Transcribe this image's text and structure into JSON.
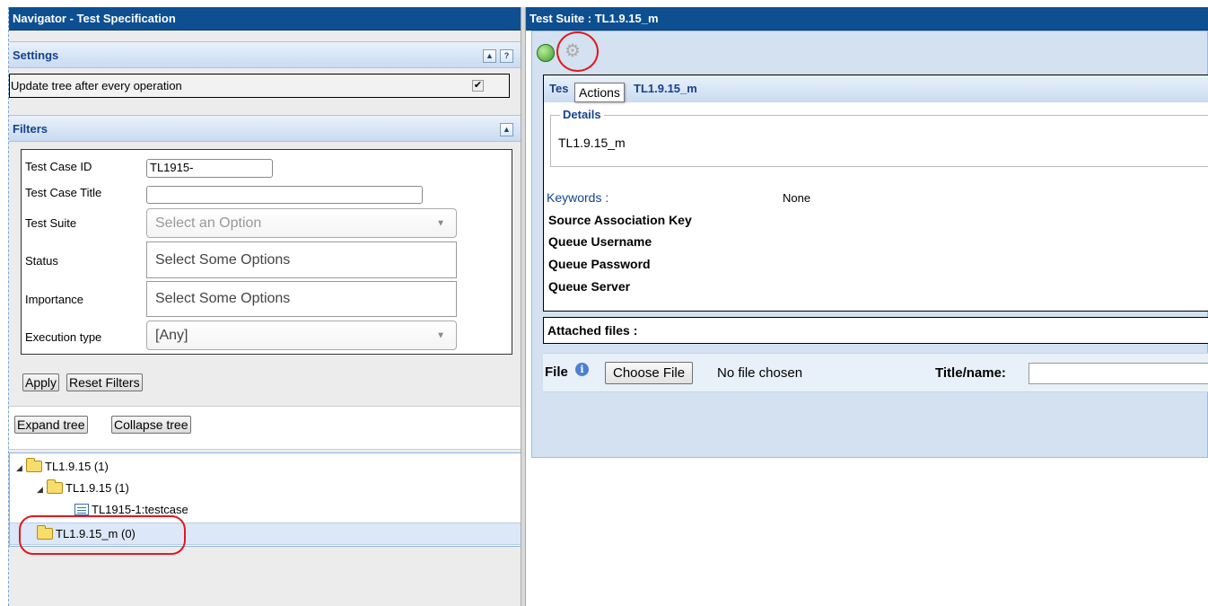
{
  "navigator": {
    "title": "Navigator - Test Specification",
    "settings": {
      "heading": "Settings",
      "update_tree_label": "Update tree after every operation",
      "update_tree_checked": true
    },
    "filters": {
      "heading": "Filters",
      "test_case_id_label": "Test Case ID",
      "test_case_id_value": "TL1915-",
      "test_case_title_label": "Test Case Title",
      "test_case_title_value": "",
      "test_suite_label": "Test Suite",
      "test_suite_value": "Select an Option",
      "status_label": "Status",
      "status_value": "Select Some Options",
      "importance_label": "Importance",
      "importance_value": "Select Some Options",
      "execution_type_label": "Execution type",
      "execution_type_value": "[Any]",
      "apply_label": "Apply",
      "reset_label": "Reset Filters"
    },
    "expand_label": "Expand tree",
    "collapse_label": "Collapse tree",
    "tree": [
      {
        "label": "TL1.9.15 (1)",
        "type": "folder",
        "expanded": true
      },
      {
        "label": "TL1.9.15 (1)",
        "type": "folder",
        "expanded": true
      },
      {
        "label": "TL1915-1:testcase",
        "type": "testcase"
      },
      {
        "label": "TL1.9.15_m (0)",
        "type": "folder",
        "selected": true
      }
    ]
  },
  "suite": {
    "title": "Test Suite : TL1.9.15_m",
    "header_prefix": "Tes",
    "header_suffix": "TL1.9.15_m",
    "actions_tooltip": "Actions",
    "details_legend": "Details",
    "details_value": "TL1.9.15_m",
    "keywords_label": "Keywords :",
    "keywords_value": "None",
    "source_key_label": "Source Association Key",
    "queue_username_label": "Queue Username",
    "queue_password_label": "Queue Password",
    "queue_server_label": "Queue Server",
    "attached_files_label": "Attached files :",
    "file_label": "File",
    "choose_file_label": "Choose File",
    "no_file_label": "No file chosen",
    "title_name_label": "Title/name:"
  },
  "colors": {
    "titlebar": "#0d4f91",
    "accent": "#15428b",
    "annotation_red": "#e0191e"
  }
}
